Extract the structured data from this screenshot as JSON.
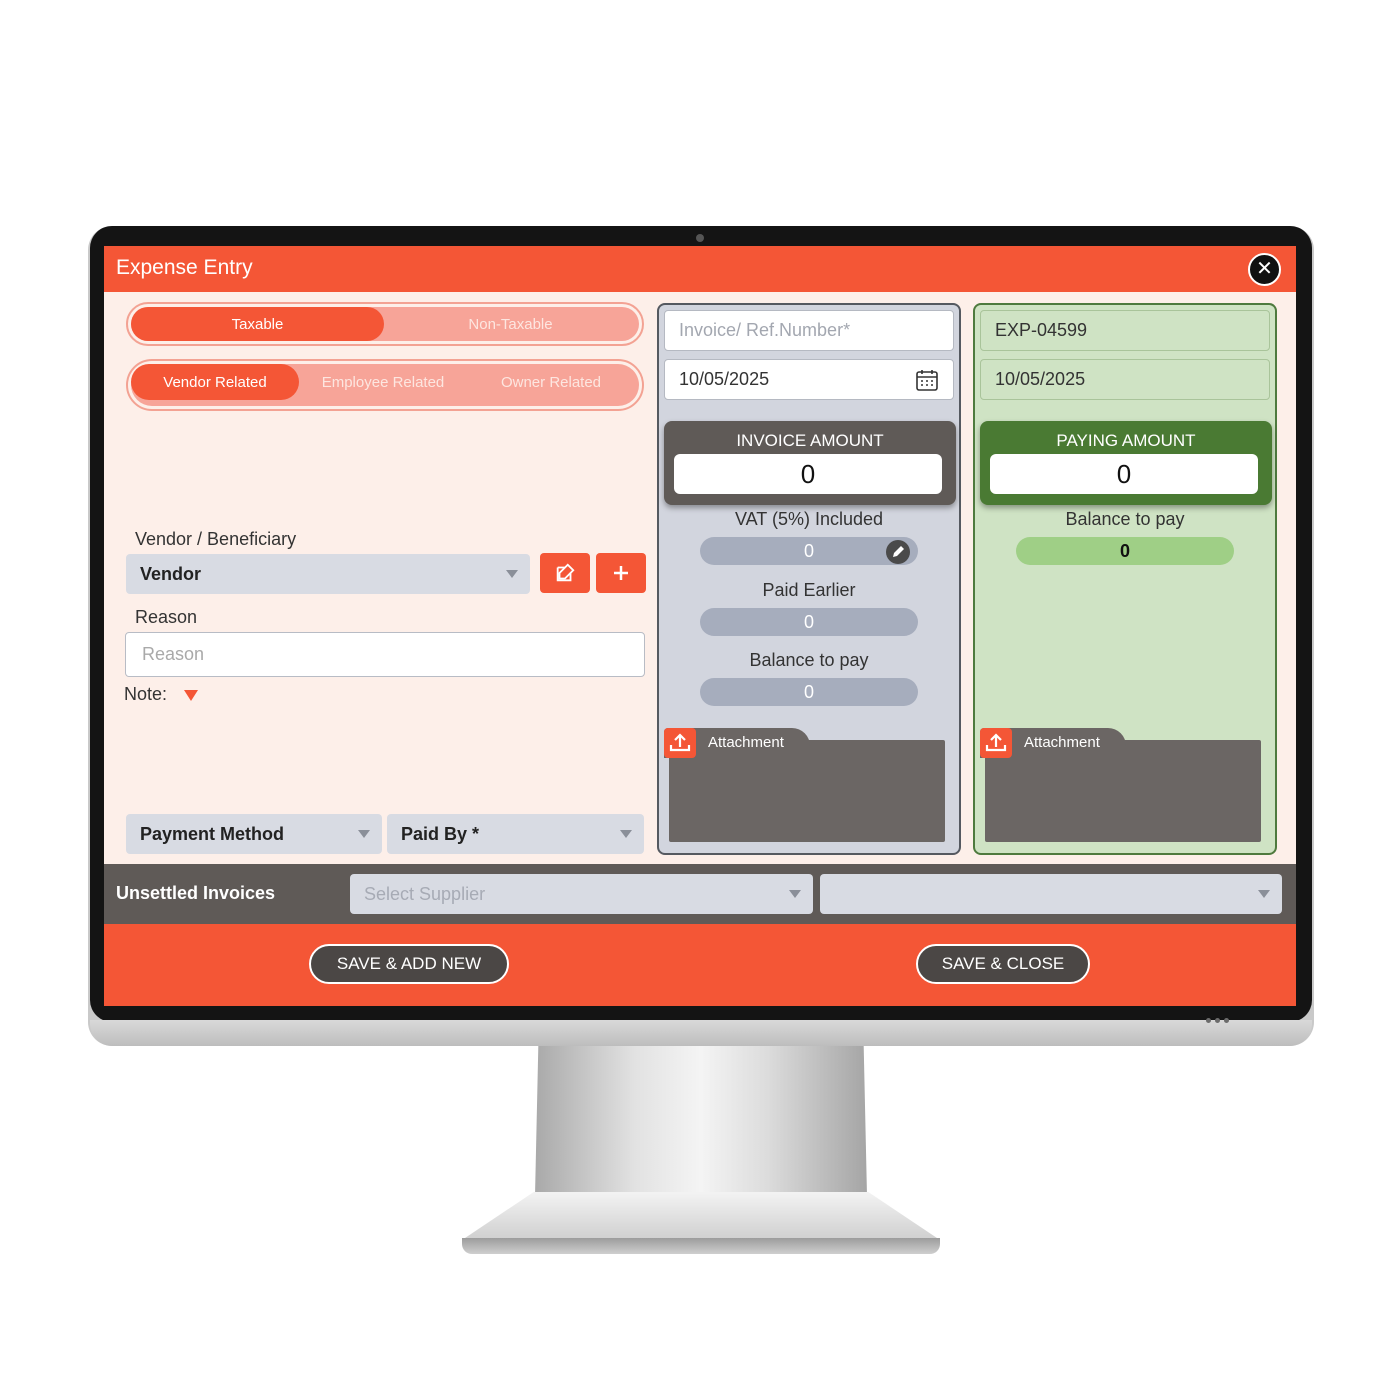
{
  "window": {
    "title": "Expense Entry"
  },
  "tax_toggle": {
    "options": [
      "Taxable",
      "Non-Taxable"
    ],
    "selected": "Taxable"
  },
  "relation_toggle": {
    "options": [
      "Vendor Related",
      "Employee Related",
      "Owner  Related"
    ],
    "selected": "Vendor Related"
  },
  "vendor": {
    "label": "Vendor / Beneficiary",
    "selected": "Vendor"
  },
  "reason": {
    "label": "Reason",
    "placeholder": "Reason",
    "value": ""
  },
  "note": {
    "label": "Note:"
  },
  "payment_method": {
    "selected": "Payment Method"
  },
  "paid_by": {
    "selected": "Paid By *"
  },
  "invoice_panel": {
    "ref_placeholder": "Invoice/ Ref.Number*",
    "date": "10/05/2025",
    "amount_title": "INVOICE AMOUNT",
    "amount_value": "0",
    "vat_label": "VAT (5%) Included",
    "vat_value": "0",
    "paid_earlier_label": "Paid Earlier",
    "paid_earlier_value": "0",
    "balance_label": "Balance to pay",
    "balance_value": "0",
    "attachment_label": "Attachment"
  },
  "paying_panel": {
    "expense_number": "EXP-04599",
    "date": "10/05/2025",
    "amount_title": "PAYING AMOUNT",
    "amount_value": "0",
    "balance_label": "Balance to pay",
    "balance_value": "0",
    "attachment_label": "Attachment"
  },
  "unsettled": {
    "label": "Unsettled Invoices",
    "supplier_placeholder": "Select Supplier",
    "invoice_selected": ""
  },
  "footer": {
    "save_add_new": "SAVE & ADD NEW",
    "save_close": "SAVE & CLOSE"
  },
  "colors": {
    "brand": "#f45636",
    "dark": "#5f5a57",
    "green": "#4a7a33",
    "form_bg": "#fdefe9"
  },
  "icons": [
    "close-icon",
    "edit-icon",
    "plus-icon",
    "calendar-icon",
    "pencil-icon",
    "upload-icon",
    "chevron-down-icon"
  ]
}
